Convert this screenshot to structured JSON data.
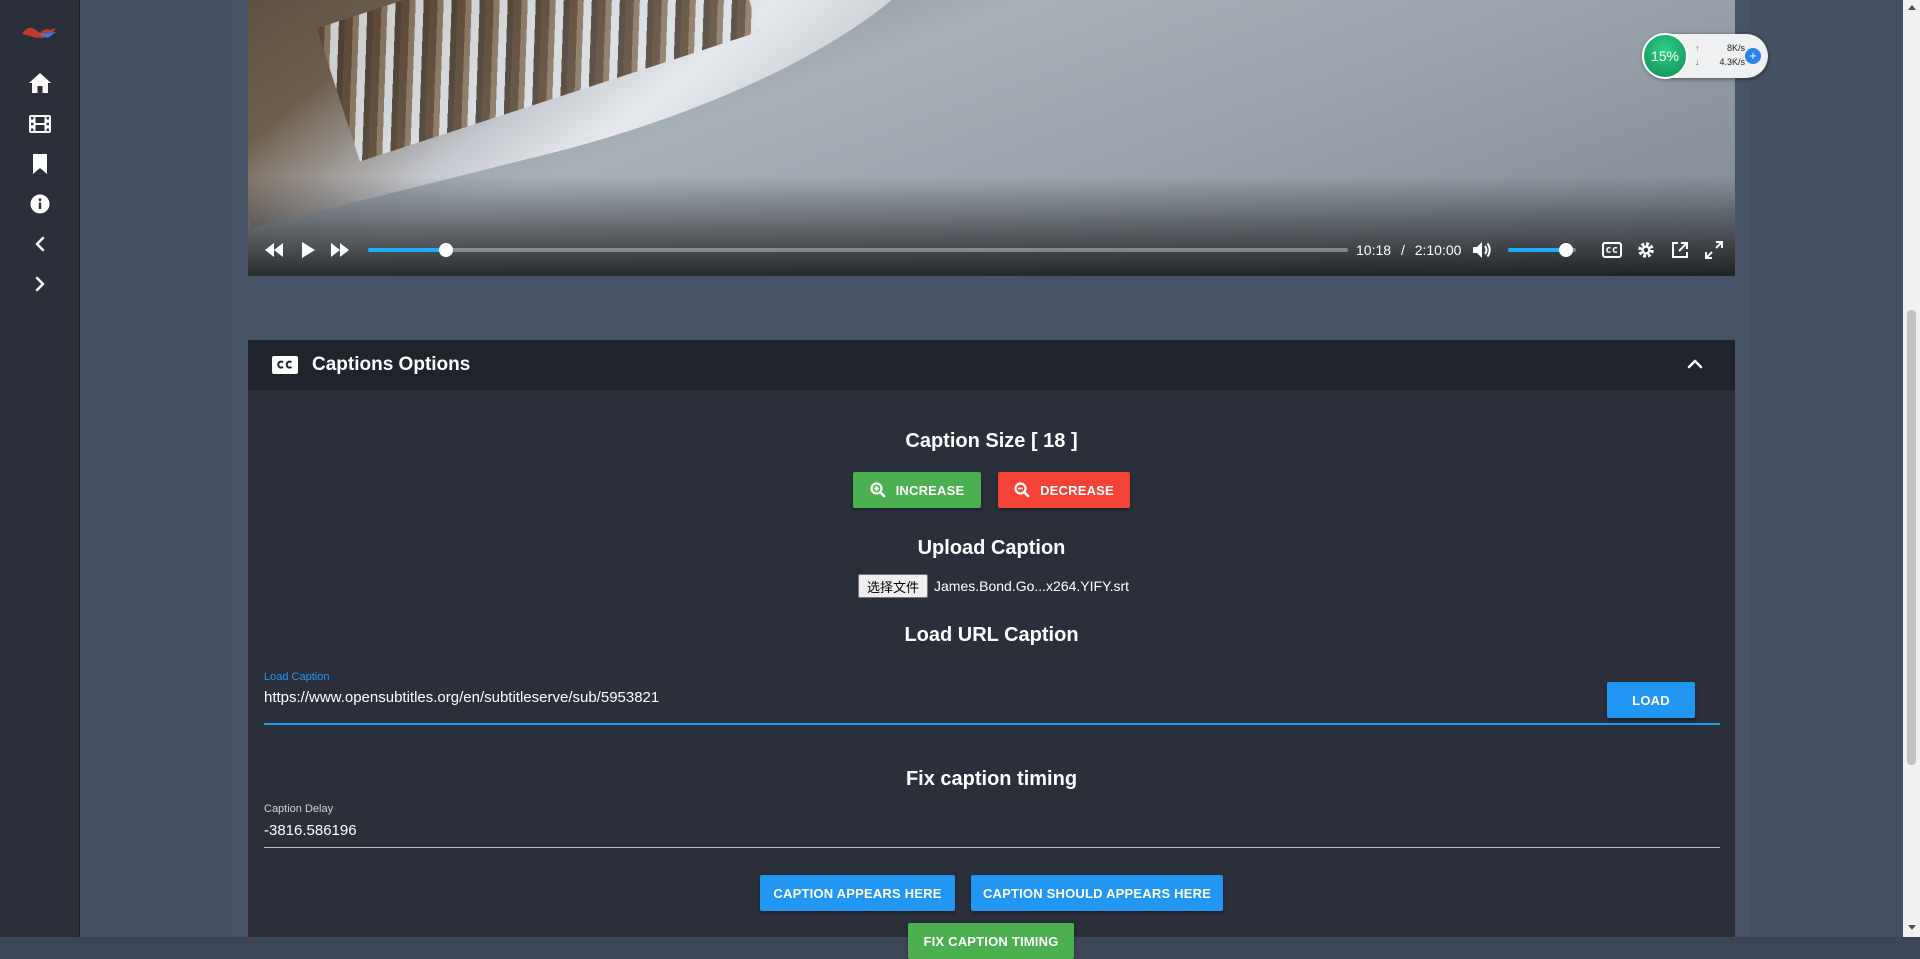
{
  "sidebar": {
    "items": [
      {
        "name": "home-icon"
      },
      {
        "name": "film-icon"
      },
      {
        "name": "bookmark-icon"
      },
      {
        "name": "info-icon"
      },
      {
        "name": "chevron-left-icon"
      },
      {
        "name": "chevron-right-icon"
      }
    ]
  },
  "player": {
    "current_time": "10:18",
    "separator": "/",
    "duration": "2:10:00",
    "progress_fraction": 0.0792,
    "volume_fraction": 0.85
  },
  "net_widget": {
    "percent": "15%",
    "upload": "8K/s",
    "download": "4.3K/s"
  },
  "captions_panel": {
    "title": "Captions Options",
    "size_heading": "Caption Size [ 18 ]",
    "increase_label": "INCREASE",
    "decrease_label": "DECREASE",
    "upload_heading": "Upload Caption",
    "file_button_label": "选择文件",
    "file_name": "James.Bond.Go...x264.YIFY.srt",
    "url_heading": "Load URL Caption",
    "url_field_label": "Load Caption",
    "url_field_value": "https://www.opensubtitles.org/en/subtitleserve/sub/5953821",
    "load_label": "LOAD",
    "timing_heading": "Fix caption timing",
    "delay_label": "Caption Delay",
    "delay_value": "-3816.586196",
    "appears_here_label": "CAPTION APPEARS HERE",
    "should_appear_label": "CAPTION SHOULD APPEARS HERE",
    "fix_timing_label": "FIX CAPTION TIMING"
  },
  "colors": {
    "accent": "#1aaffa",
    "green": "#4caf50",
    "red": "#f44336",
    "blue": "#2196f3"
  }
}
